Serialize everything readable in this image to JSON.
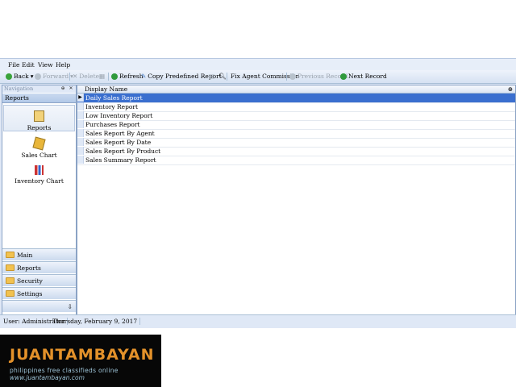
{
  "menu": [
    "File",
    "Edit",
    "View",
    "Help"
  ],
  "toolbar": {
    "back": "Back",
    "forward": "Forward",
    "delete": "Delete",
    "refresh": "Refresh",
    "copy_report": "Copy Predefined Report",
    "fix_commission": "Fix Agent Commission",
    "previous_record": "Previous Record",
    "next_record": "Next Record"
  },
  "navigation": {
    "title": "Navigation",
    "group": "Reports",
    "items": [
      {
        "label": "Reports",
        "icon": "clipboard-icon"
      },
      {
        "label": "Sales Chart",
        "icon": "cube-chart-icon"
      },
      {
        "label": "Inventory Chart",
        "icon": "bar-chart-icon"
      }
    ],
    "panes": [
      "Main",
      "Reports",
      "Security",
      "Settings"
    ]
  },
  "grid": {
    "column": "Display Name",
    "rows": [
      "Daily Sales Report",
      "Inventory Report",
      "Low Inventory Report",
      "Purchases Report",
      "Sales Report By Agent",
      "Sales Report By Date",
      "Sales Report By Product",
      "Sales Summary Report"
    ]
  },
  "status": {
    "user": "User: Administrator",
    "date": "Thursday, February 9, 2017"
  },
  "watermark": {
    "brand": "JUANTAMBAYAN",
    "tagline": "philippines   free classifieds online",
    "url": "www.juantambayan.com"
  }
}
